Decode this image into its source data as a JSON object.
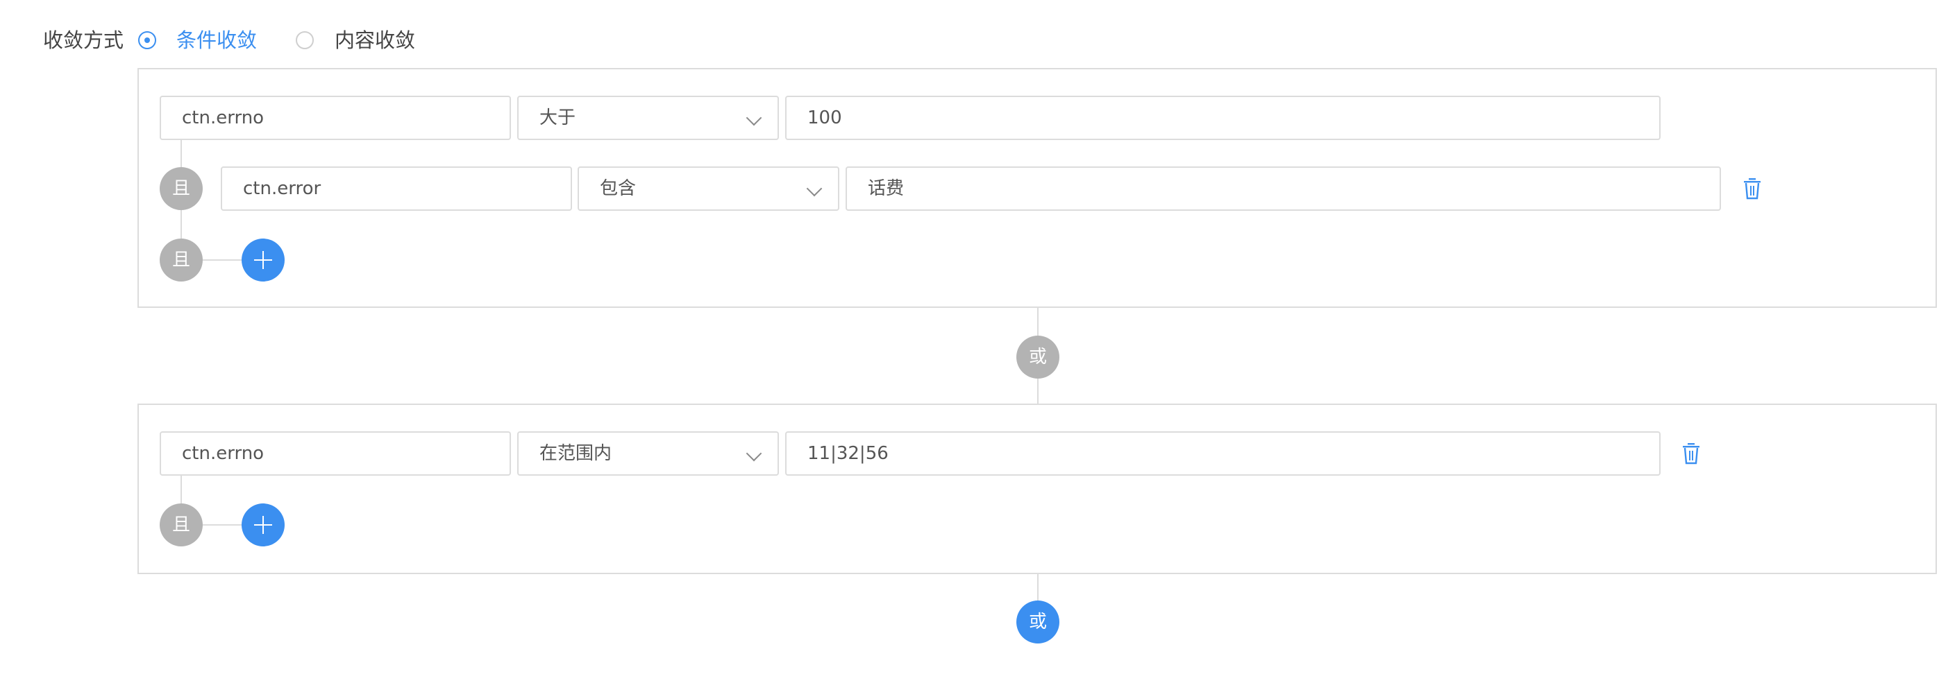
{
  "convergence": {
    "label": "收敛方式",
    "options": [
      {
        "label": "条件收敛",
        "selected": true
      },
      {
        "label": "内容收敛",
        "selected": false
      }
    ]
  },
  "groups": [
    {
      "rows": [
        {
          "field": "ctn.errno",
          "operator": "大于",
          "value": "100"
        },
        {
          "connector": "且",
          "field": "ctn.error",
          "operator": "包含",
          "value": "话费"
        }
      ],
      "add_connector": "且"
    },
    {
      "rows": [
        {
          "field": "ctn.errno",
          "operator": "在范围内",
          "value": "11|32|56"
        }
      ],
      "add_connector": "且"
    }
  ],
  "or_label": "或",
  "add_or_label": "或",
  "colors": {
    "accent": "#3b8ff0",
    "connector_grey": "#b3b3b3",
    "border": "#dcdcdc"
  },
  "icons": {
    "delete": "trash-icon",
    "add": "plus-icon",
    "dropdown": "chevron-down-icon"
  }
}
